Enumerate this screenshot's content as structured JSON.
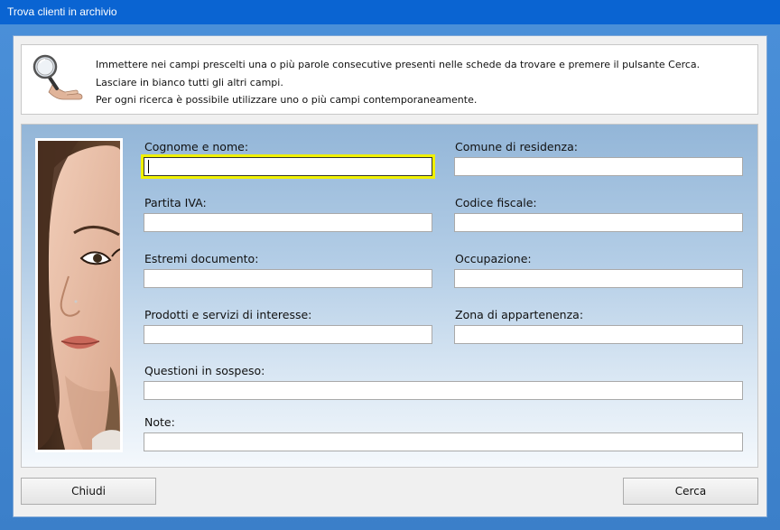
{
  "window": {
    "title": "Trova clienti in archivio"
  },
  "info": {
    "icon": "magnifier-icon",
    "line1": "Immettere nei campi prescelti una o più parole consecutive presenti nelle schede da trovare e premere il pulsante Cerca.",
    "line2": "Lasciare in bianco tutti gli altri campi.",
    "line3": "Per ogni ricerca è possibile utilizzare uno o più campi contemporaneamente."
  },
  "form": {
    "cognome_nome": {
      "label": "Cognome e nome:",
      "value": ""
    },
    "comune_residenza": {
      "label": "Comune di residenza:",
      "value": ""
    },
    "partita_iva": {
      "label": "Partita IVA:",
      "value": ""
    },
    "codice_fiscale": {
      "label": "Codice fiscale:",
      "value": ""
    },
    "estremi_documento": {
      "label": "Estremi documento:",
      "value": ""
    },
    "occupazione": {
      "label": "Occupazione:",
      "value": ""
    },
    "prodotti_servizi": {
      "label": "Prodotti e servizi di interesse:",
      "value": ""
    },
    "zona_appartenenza": {
      "label": "Zona di appartenenza:",
      "value": ""
    },
    "questioni_sospeso": {
      "label": "Questioni in sospeso:",
      "value": ""
    },
    "note": {
      "label": "Note:",
      "value": ""
    }
  },
  "buttons": {
    "chiudi": "Chiudi",
    "cerca": "Cerca"
  },
  "colors": {
    "titlebar": "#0a64d2",
    "focus_highlight": "#f0f000"
  }
}
